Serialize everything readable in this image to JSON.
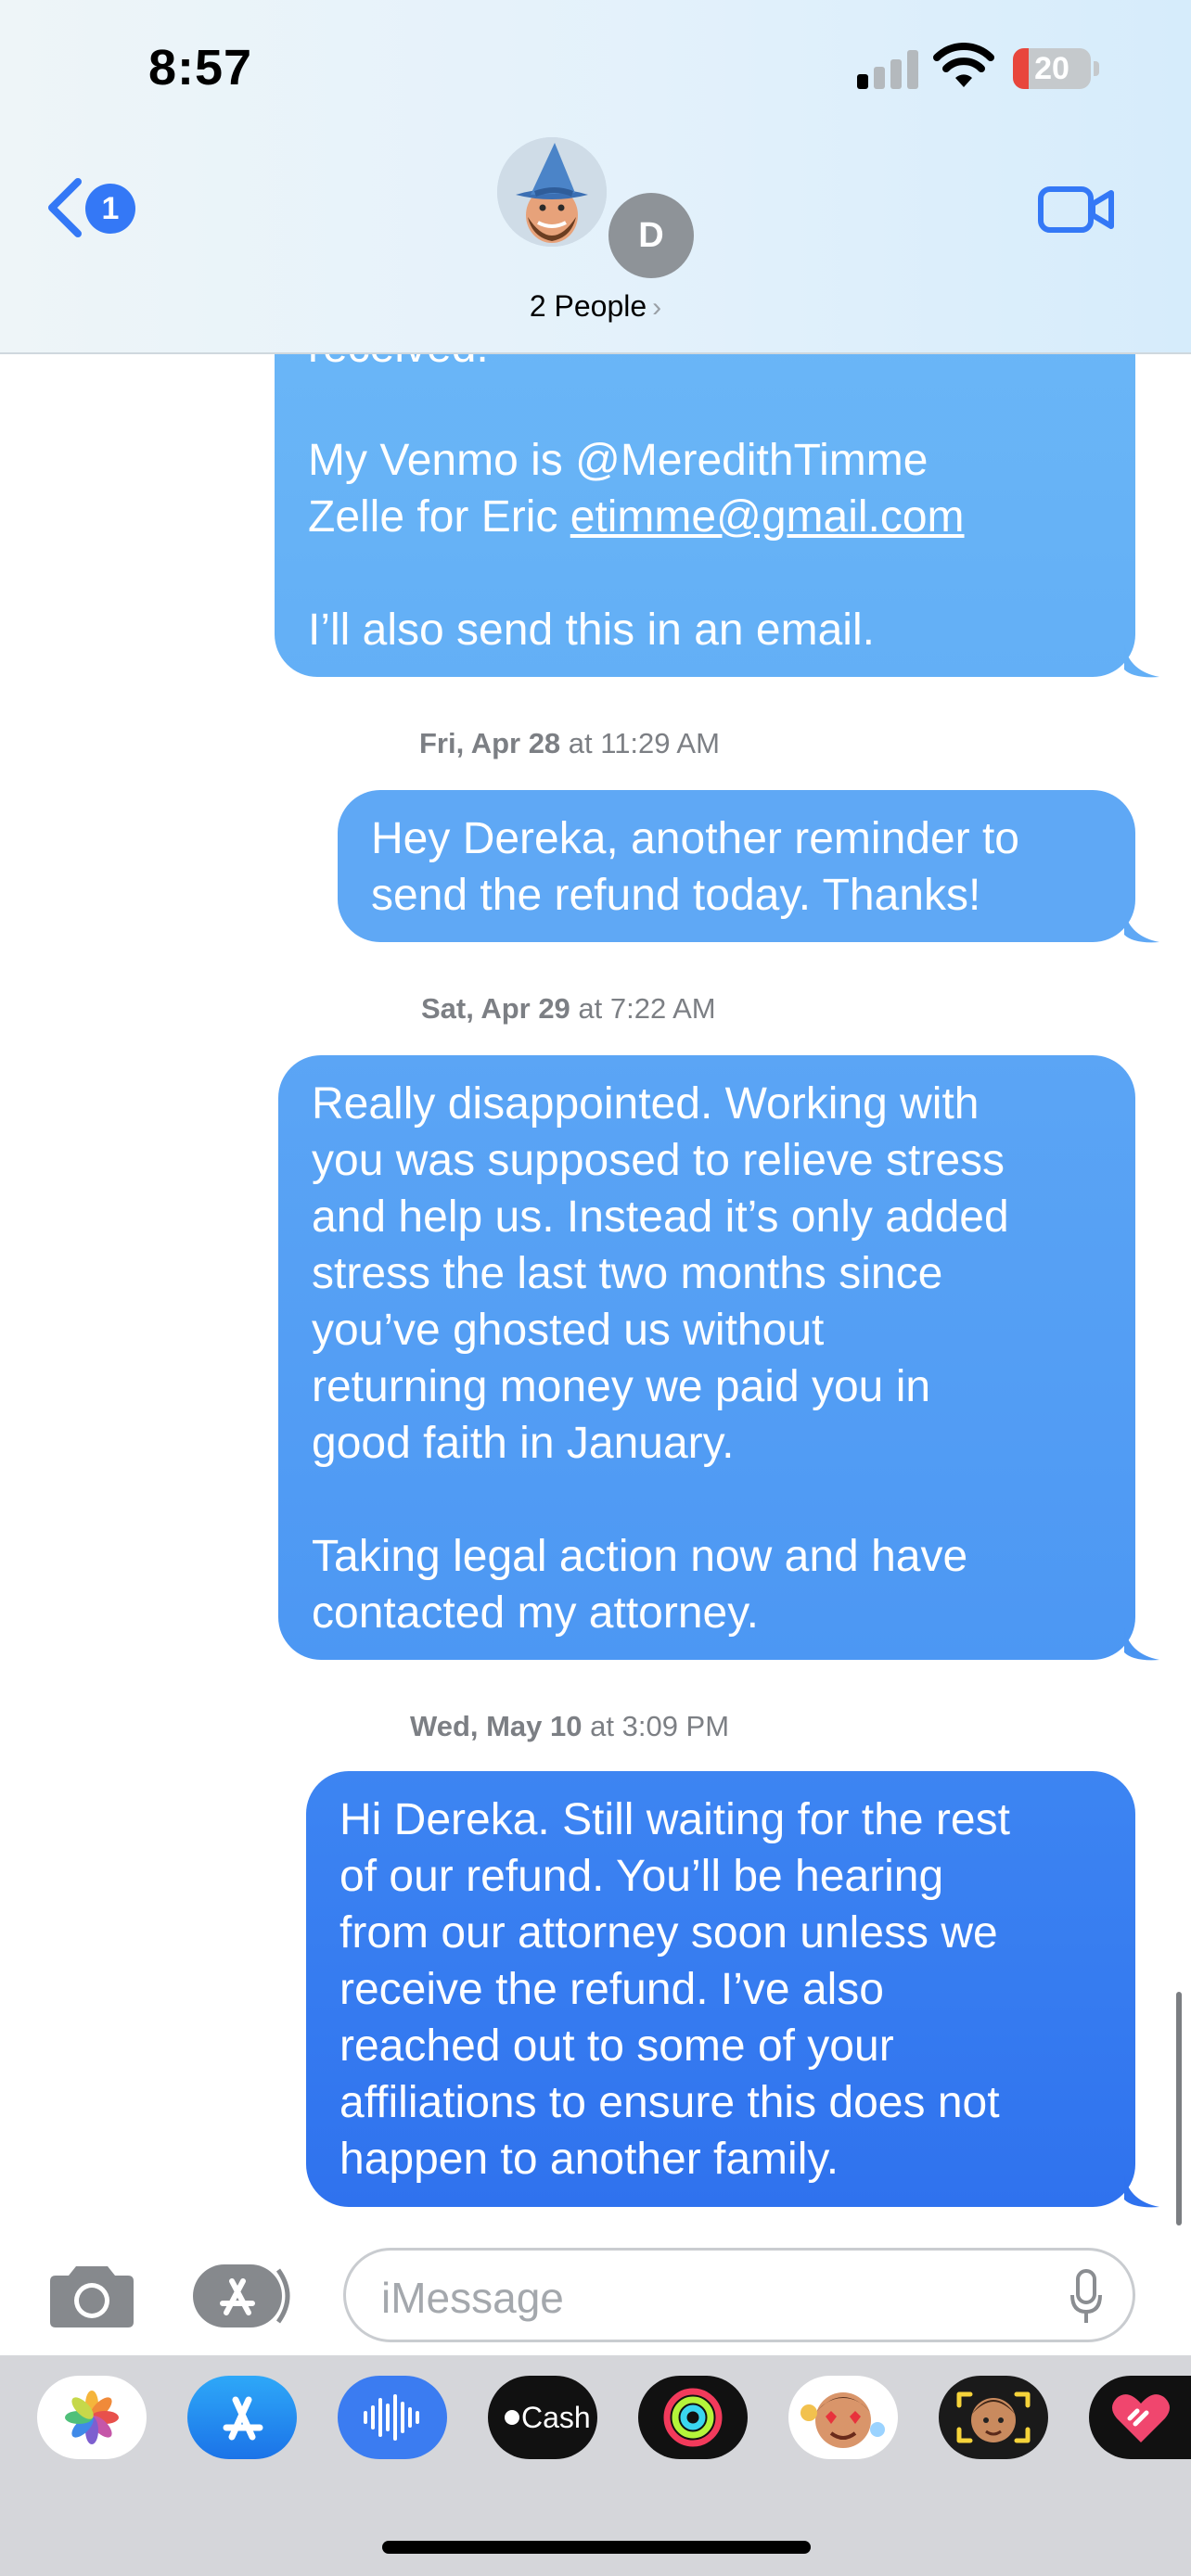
{
  "status_bar": {
    "time": "8:57",
    "battery": "20",
    "signal_bars_active": 1,
    "signal_bars_total": 4
  },
  "header": {
    "back_badge": "1",
    "member_initial": "D",
    "people_label": "2 People",
    "people_chevron": "›"
  },
  "messages": [
    {
      "kind": "sent",
      "text_parts": [
        "received.\n\nMy Venmo is @MeredithTimme\nZelle for Eric ",
        "etimme@gmail.com",
        "\n\nI’ll also send this in an email."
      ]
    },
    {
      "kind": "timestamp",
      "day": "Fri, Apr 28",
      "time": " at 11:29 AM"
    },
    {
      "kind": "sent",
      "text": "Hey Dereka, another reminder to\nsend the refund today. Thanks!"
    },
    {
      "kind": "timestamp",
      "day": "Sat, Apr 29",
      "time": " at 7:22 AM"
    },
    {
      "kind": "sent",
      "text": "Really disappointed. Working with\nyou was supposed to relieve stress\nand help us. Instead it’s only added\nstress the last two months since\nyou’ve ghosted us without\nreturning money we paid you in\ngood faith in January.\n\nTaking legal action now and have\ncontacted my attorney."
    },
    {
      "kind": "timestamp",
      "day": "Wed, May 10",
      "time": " at 3:09 PM"
    },
    {
      "kind": "sent",
      "text": "Hi Dereka. Still waiting for the rest\nof our refund. You’ll be hearing\nfrom our attorney soon unless we\nreceive the refund. I’ve also\nreached out to some of your\naffiliations to ensure this does not\nhappen to another family."
    }
  ],
  "composer": {
    "placeholder": "iMessage"
  },
  "app_drawer": {
    "apps": [
      {
        "name": "photos-app-icon"
      },
      {
        "name": "app-store-app-icon"
      },
      {
        "name": "audio-message-app-icon"
      },
      {
        "name": "apple-cash-app-icon",
        "label": "Cash"
      },
      {
        "name": "activity-app-icon"
      },
      {
        "name": "memoji-stickers-app-icon"
      },
      {
        "name": "memoji-app-icon"
      },
      {
        "name": "digital-touch-app-icon"
      }
    ]
  },
  "colors": {
    "bubble_top": "#69b5f6",
    "bubble_bottom": "#2f72ee",
    "accent": "#3478f6"
  }
}
